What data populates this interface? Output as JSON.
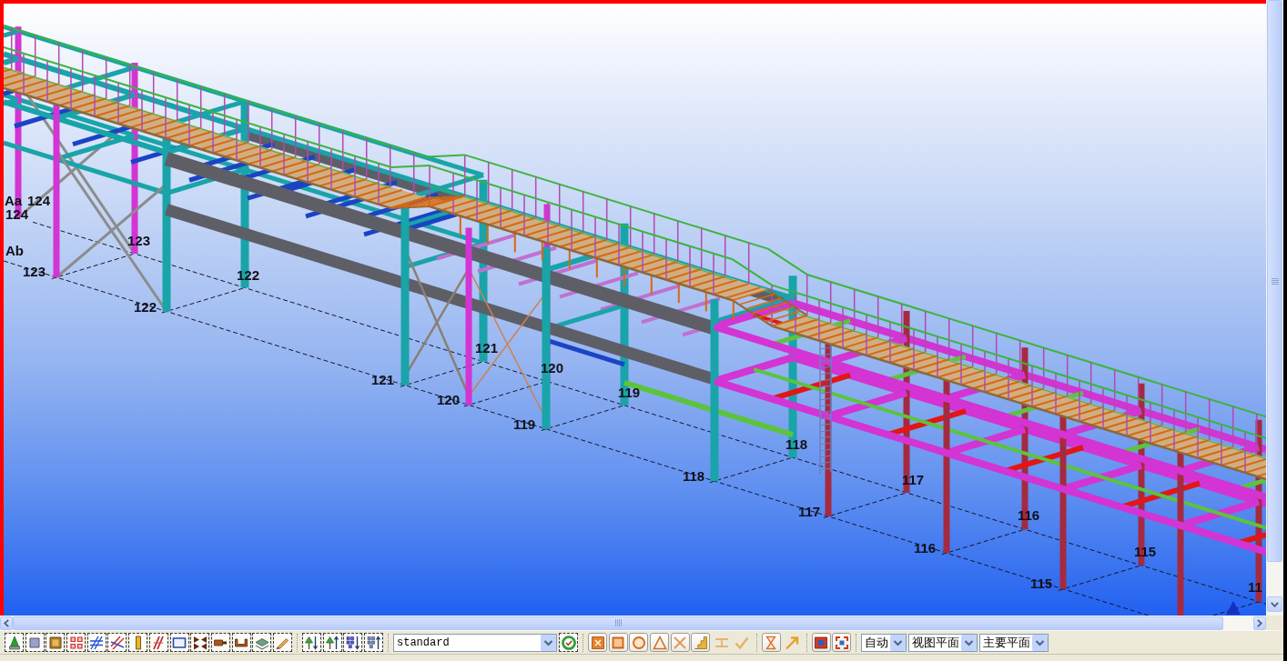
{
  "model_view": {
    "active": true,
    "grid_labels": [
      "Aa",
      "124",
      "124",
      "Ab",
      "123",
      "123",
      "122",
      "122",
      "121",
      "121",
      "120",
      "120",
      "119",
      "119",
      "118",
      "118",
      "117",
      "117",
      "116",
      "116",
      "115",
      "115",
      "11"
    ]
  },
  "toolbar": [
    {
      "kind": "select_switches",
      "buttons": [
        {
          "on": true
        },
        {
          "on": true
        },
        {
          "on": true
        },
        {
          "on": true
        },
        {
          "on": true
        },
        {
          "on": true
        },
        {
          "on": true
        },
        {
          "on": true
        },
        {
          "on": true
        },
        {
          "on": true
        },
        {
          "on": true
        },
        {
          "on": true
        },
        {
          "on": true
        },
        {
          "on": true
        }
      ]
    },
    {
      "kind": "select_switches",
      "buttons": [
        {
          "on": true
        },
        {
          "on": true
        },
        {
          "on": true
        },
        {
          "on": true
        }
      ]
    },
    {
      "kind": "dropdown",
      "value": "standard"
    },
    {
      "kind": "select_switches",
      "buttons": [
        {
          "on": true
        }
      ]
    },
    {
      "kind": "snap_switches",
      "buttons": [
        {
          "on": true
        },
        {
          "on": true
        },
        {
          "on": true
        },
        {
          "on": true
        },
        {
          "on": true
        },
        {
          "on": true
        },
        {
          "on": false
        },
        {
          "on": false
        }
      ]
    },
    {
      "kind": "snap_switches",
      "buttons": [
        {
          "on": true
        },
        {
          "on": false
        }
      ]
    },
    {
      "kind": "snap_switches",
      "buttons": [
        {
          "on": true
        },
        {
          "on": true
        }
      ]
    },
    {
      "kind": "dropdown",
      "value": "自动"
    },
    {
      "kind": "dropdown",
      "value": "视图平面"
    },
    {
      "kind": "dropdown",
      "value": "主要平面"
    }
  ]
}
